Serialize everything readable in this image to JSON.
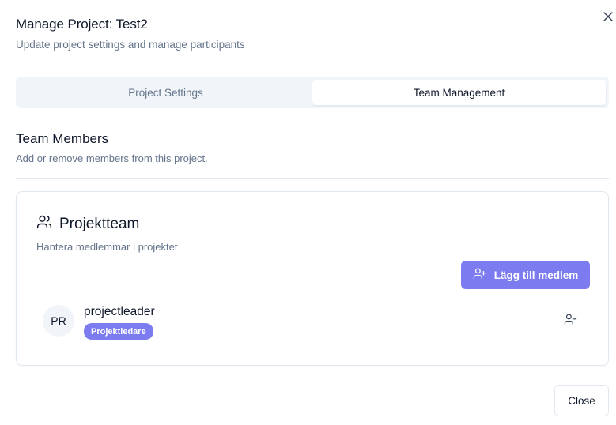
{
  "dialog": {
    "title": "Manage Project: Test2",
    "subtitle": "Update project settings and manage participants",
    "close_icon": "close-icon"
  },
  "tabs": [
    {
      "label": "Project Settings",
      "active": false
    },
    {
      "label": "Team Management",
      "active": true
    }
  ],
  "team_section": {
    "title": "Team Members",
    "description": "Add or remove members from this project."
  },
  "card": {
    "icon": "users-icon",
    "title": "Projektteam",
    "description": "Hantera medlemmar i projektet",
    "add_button": {
      "label": "Lägg till medlem",
      "icon": "user-plus-icon"
    }
  },
  "members": [
    {
      "initials": "PR",
      "name": "projectleader",
      "role": "Projektledare",
      "remove_icon": "user-minus-icon"
    }
  ],
  "footer": {
    "close_label": "Close"
  },
  "colors": {
    "accent": "#7c7cf0",
    "muted_text": "#64748b",
    "border": "#e2e8f0",
    "tab_bg": "#f1f5f9"
  }
}
